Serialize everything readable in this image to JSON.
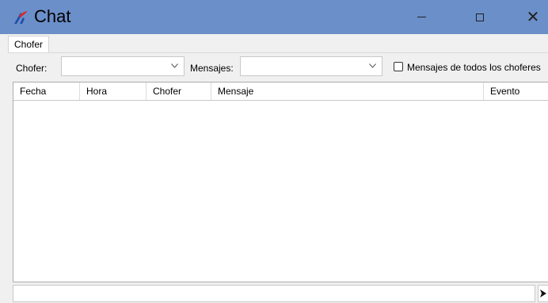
{
  "window": {
    "title": "Chat",
    "controls": {
      "minimize": "minimize",
      "maximize": "maximize",
      "close": "✕"
    }
  },
  "tabs": [
    {
      "label": "Chofer",
      "selected": true
    }
  ],
  "filters": {
    "chofer_label": "Chofer:",
    "chofer_value": "",
    "mensajes_label": "Mensajes:",
    "mensajes_value": "",
    "all_drivers_checkbox": {
      "label": "Mensajes de todos los choferes",
      "checked": false
    }
  },
  "grid": {
    "columns": [
      "Fecha",
      "Hora",
      "Chofer",
      "Mensaje",
      "Evento"
    ],
    "rows": []
  },
  "message_input": {
    "value": ""
  },
  "colors": {
    "titlebar": "#6b8fc9",
    "background": "#f0f0f0",
    "icon_red": "#e0262a",
    "icon_blue": "#1f4fa8"
  }
}
